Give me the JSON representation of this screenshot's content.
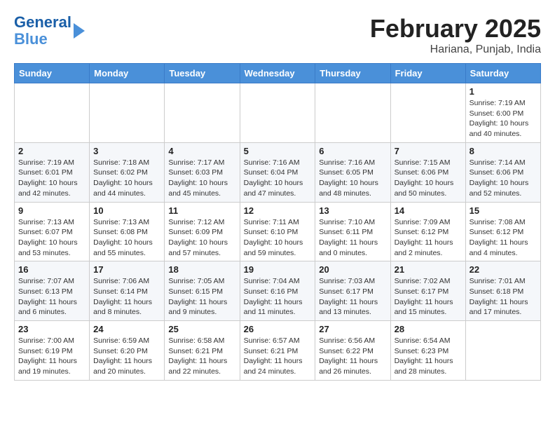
{
  "header": {
    "logo_line1": "General",
    "logo_line2": "Blue",
    "main_title": "February 2025",
    "subtitle": "Hariana, Punjab, India"
  },
  "weekdays": [
    "Sunday",
    "Monday",
    "Tuesday",
    "Wednesday",
    "Thursday",
    "Friday",
    "Saturday"
  ],
  "weeks": [
    [
      {
        "day": "",
        "info": ""
      },
      {
        "day": "",
        "info": ""
      },
      {
        "day": "",
        "info": ""
      },
      {
        "day": "",
        "info": ""
      },
      {
        "day": "",
        "info": ""
      },
      {
        "day": "",
        "info": ""
      },
      {
        "day": "1",
        "info": "Sunrise: 7:19 AM\nSunset: 6:00 PM\nDaylight: 10 hours\nand 40 minutes."
      }
    ],
    [
      {
        "day": "2",
        "info": "Sunrise: 7:19 AM\nSunset: 6:01 PM\nDaylight: 10 hours\nand 42 minutes."
      },
      {
        "day": "3",
        "info": "Sunrise: 7:18 AM\nSunset: 6:02 PM\nDaylight: 10 hours\nand 44 minutes."
      },
      {
        "day": "4",
        "info": "Sunrise: 7:17 AM\nSunset: 6:03 PM\nDaylight: 10 hours\nand 45 minutes."
      },
      {
        "day": "5",
        "info": "Sunrise: 7:16 AM\nSunset: 6:04 PM\nDaylight: 10 hours\nand 47 minutes."
      },
      {
        "day": "6",
        "info": "Sunrise: 7:16 AM\nSunset: 6:05 PM\nDaylight: 10 hours\nand 48 minutes."
      },
      {
        "day": "7",
        "info": "Sunrise: 7:15 AM\nSunset: 6:06 PM\nDaylight: 10 hours\nand 50 minutes."
      },
      {
        "day": "8",
        "info": "Sunrise: 7:14 AM\nSunset: 6:06 PM\nDaylight: 10 hours\nand 52 minutes."
      }
    ],
    [
      {
        "day": "9",
        "info": "Sunrise: 7:13 AM\nSunset: 6:07 PM\nDaylight: 10 hours\nand 53 minutes."
      },
      {
        "day": "10",
        "info": "Sunrise: 7:13 AM\nSunset: 6:08 PM\nDaylight: 10 hours\nand 55 minutes."
      },
      {
        "day": "11",
        "info": "Sunrise: 7:12 AM\nSunset: 6:09 PM\nDaylight: 10 hours\nand 57 minutes."
      },
      {
        "day": "12",
        "info": "Sunrise: 7:11 AM\nSunset: 6:10 PM\nDaylight: 10 hours\nand 59 minutes."
      },
      {
        "day": "13",
        "info": "Sunrise: 7:10 AM\nSunset: 6:11 PM\nDaylight: 11 hours\nand 0 minutes."
      },
      {
        "day": "14",
        "info": "Sunrise: 7:09 AM\nSunset: 6:12 PM\nDaylight: 11 hours\nand 2 minutes."
      },
      {
        "day": "15",
        "info": "Sunrise: 7:08 AM\nSunset: 6:12 PM\nDaylight: 11 hours\nand 4 minutes."
      }
    ],
    [
      {
        "day": "16",
        "info": "Sunrise: 7:07 AM\nSunset: 6:13 PM\nDaylight: 11 hours\nand 6 minutes."
      },
      {
        "day": "17",
        "info": "Sunrise: 7:06 AM\nSunset: 6:14 PM\nDaylight: 11 hours\nand 8 minutes."
      },
      {
        "day": "18",
        "info": "Sunrise: 7:05 AM\nSunset: 6:15 PM\nDaylight: 11 hours\nand 9 minutes."
      },
      {
        "day": "19",
        "info": "Sunrise: 7:04 AM\nSunset: 6:16 PM\nDaylight: 11 hours\nand 11 minutes."
      },
      {
        "day": "20",
        "info": "Sunrise: 7:03 AM\nSunset: 6:17 PM\nDaylight: 11 hours\nand 13 minutes."
      },
      {
        "day": "21",
        "info": "Sunrise: 7:02 AM\nSunset: 6:17 PM\nDaylight: 11 hours\nand 15 minutes."
      },
      {
        "day": "22",
        "info": "Sunrise: 7:01 AM\nSunset: 6:18 PM\nDaylight: 11 hours\nand 17 minutes."
      }
    ],
    [
      {
        "day": "23",
        "info": "Sunrise: 7:00 AM\nSunset: 6:19 PM\nDaylight: 11 hours\nand 19 minutes."
      },
      {
        "day": "24",
        "info": "Sunrise: 6:59 AM\nSunset: 6:20 PM\nDaylight: 11 hours\nand 20 minutes."
      },
      {
        "day": "25",
        "info": "Sunrise: 6:58 AM\nSunset: 6:21 PM\nDaylight: 11 hours\nand 22 minutes."
      },
      {
        "day": "26",
        "info": "Sunrise: 6:57 AM\nSunset: 6:21 PM\nDaylight: 11 hours\nand 24 minutes."
      },
      {
        "day": "27",
        "info": "Sunrise: 6:56 AM\nSunset: 6:22 PM\nDaylight: 11 hours\nand 26 minutes."
      },
      {
        "day": "28",
        "info": "Sunrise: 6:54 AM\nSunset: 6:23 PM\nDaylight: 11 hours\nand 28 minutes."
      },
      {
        "day": "",
        "info": ""
      }
    ]
  ]
}
